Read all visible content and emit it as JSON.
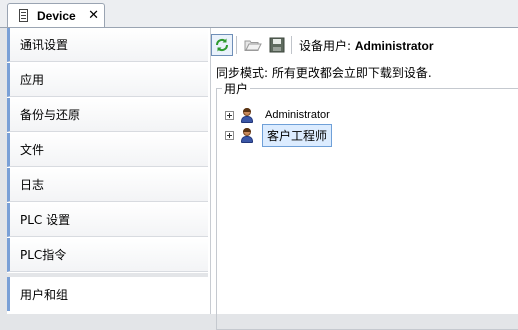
{
  "document_tab": {
    "title": "Device",
    "close_icon": "close-icon"
  },
  "sidebar": {
    "items": [
      {
        "label": "通讯设置"
      },
      {
        "label": "应用"
      },
      {
        "label": "备份与还原"
      },
      {
        "label": "文件"
      },
      {
        "label": "日志"
      },
      {
        "label": "PLC 设置"
      },
      {
        "label": "PLC指令"
      },
      {
        "label": "用户和组",
        "active": true
      }
    ]
  },
  "toolbar": {
    "buttons": [
      "refresh-icon",
      "open-folder-icon",
      "save-icon"
    ],
    "device_user_label": "设备用户:",
    "device_user_value": "Administrator"
  },
  "sync_mode_text": "同步模式: 所有更改都会立即下载到设备.",
  "users_group": {
    "title": "用户",
    "users": [
      {
        "name": "Administrator",
        "selected": false
      },
      {
        "name": "客户工程师",
        "selected": true
      }
    ]
  },
  "colors": {
    "accent": "#7aa0d6",
    "selection": "#dcecff",
    "refresh": "#2e9a2e"
  }
}
